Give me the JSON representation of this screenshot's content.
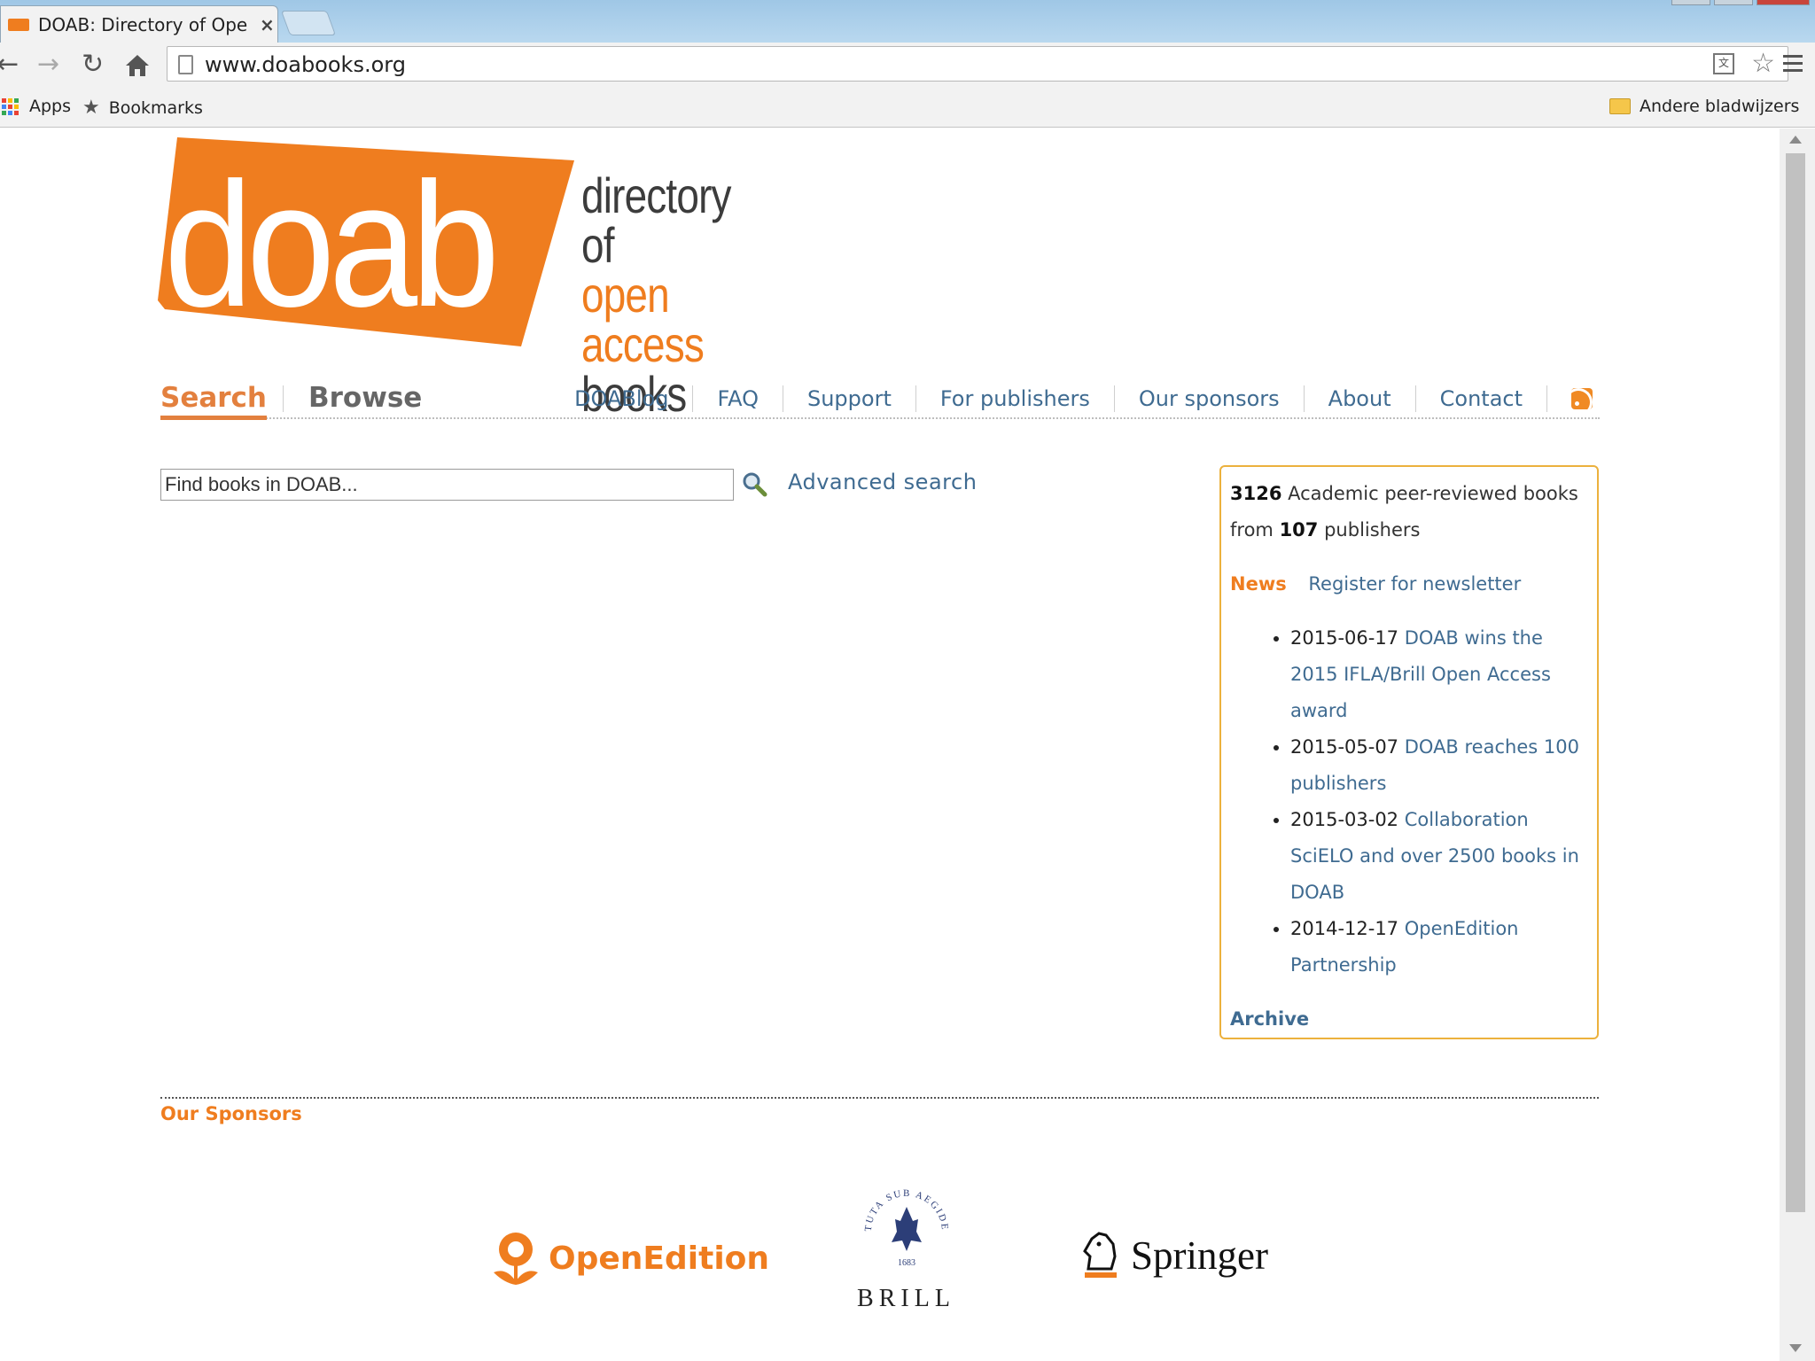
{
  "browser": {
    "tab_title": "DOAB: Directory of Open",
    "tab_close": "×",
    "url": "www.doabooks.org",
    "bookmarks": {
      "apps": "Apps",
      "bookmarks": "Bookmarks",
      "other": "Andere bladwijzers"
    }
  },
  "logo": {
    "wordmark": "doab",
    "line1": "directory of",
    "line2": "open access",
    "line3": "books"
  },
  "nav": {
    "tab_search": "Search",
    "tab_browse": "Browse",
    "links": [
      {
        "label": "DOABlog"
      },
      {
        "label": "FAQ"
      },
      {
        "label": "Support"
      },
      {
        "label": "For publishers"
      },
      {
        "label": "Our sponsors"
      },
      {
        "label": "About"
      },
      {
        "label": "Contact"
      }
    ]
  },
  "search": {
    "placeholder": "Find books in DOAB...",
    "advanced_label": "Advanced search"
  },
  "sidebox": {
    "book_count": "3126",
    "book_text": "Academic peer-reviewed books",
    "from_text": "from",
    "publisher_count": "107",
    "publisher_text": "publishers",
    "news_label": "News",
    "newsletter_label": "Register for newsletter",
    "news": [
      {
        "date": "2015-06-17",
        "title": "DOAB wins the 2015 IFLA/Brill Open Access award"
      },
      {
        "date": "2015-05-07",
        "title": "DOAB reaches 100 publishers"
      },
      {
        "date": "2015-03-02",
        "title": "Collaboration SciELO and over 2500 books in DOAB"
      },
      {
        "date": "2014-12-17",
        "title": "OpenEdition Partnership"
      }
    ],
    "archive_label": "Archive"
  },
  "sponsors": {
    "title": "Our Sponsors",
    "openedition": "OpenEdition",
    "brill": "BRILL",
    "brill_seal_text": "TUTA SUB AEGIDE PALLAS",
    "brill_year": "1683",
    "springer": "Springer"
  },
  "colors": {
    "brand_orange": "#ef7d1f",
    "link_blue": "#3f6b91",
    "box_border": "#ecb13d"
  }
}
